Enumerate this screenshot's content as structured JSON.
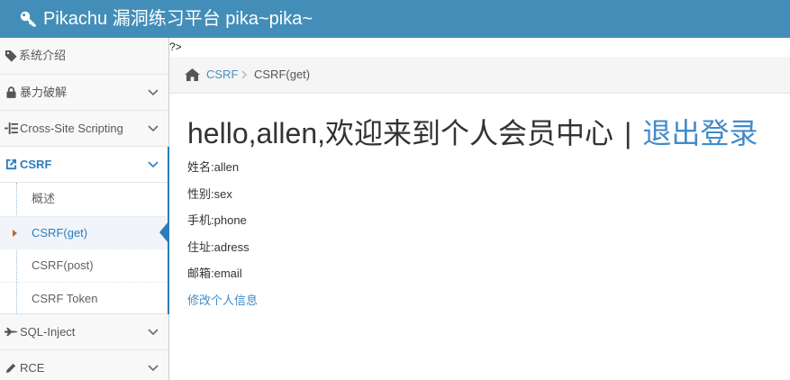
{
  "header": {
    "icon": "key-icon",
    "brand": "Pikachu 漏洞练习平台 pika~pika~"
  },
  "page_prefix_text": "?>",
  "sidebar": {
    "items": [
      {
        "label": "系统介绍",
        "icon": "tag-icon",
        "expandable": false
      },
      {
        "label": "暴力破解",
        "icon": "lock-icon",
        "expandable": true
      },
      {
        "label": "Cross-Site Scripting",
        "icon": "list-icon",
        "expandable": true
      },
      {
        "label": "CSRF",
        "icon": "share-icon",
        "expandable": true,
        "open": true,
        "active": true,
        "children": [
          {
            "label": "概述"
          },
          {
            "label": "CSRF(get)",
            "active": true,
            "icon": "caret-right-icon"
          },
          {
            "label": "CSRF(post)"
          },
          {
            "label": "CSRF Token"
          }
        ]
      },
      {
        "label": "SQL-Inject",
        "icon": "plane-icon",
        "expandable": true
      },
      {
        "label": "RCE",
        "icon": "pencil-icon",
        "expandable": true
      }
    ]
  },
  "breadcrumb": {
    "home_icon": "home-icon",
    "separator_icon": "chevron-right-icon",
    "items": [
      "CSRF",
      "CSRF(get)"
    ]
  },
  "main": {
    "greeting": "hello,allen,欢迎来到个人会员中心",
    "divider": "|",
    "logout_link": "退出登录",
    "profile": [
      {
        "label": "姓名:",
        "value": "allen"
      },
      {
        "label": "性别:",
        "value": "sex"
      },
      {
        "label": "手机:",
        "value": "phone"
      },
      {
        "label": "住址:",
        "value": "adress"
      },
      {
        "label": "邮箱:",
        "value": "email"
      }
    ],
    "edit_link": "修改个人信息"
  },
  "colors": {
    "header_bg": "#438eb9",
    "active_menu": "#2b7dbc",
    "link": "#428bca",
    "breadcrumb_link": "#4c8fbd",
    "caret": "#c86139"
  }
}
